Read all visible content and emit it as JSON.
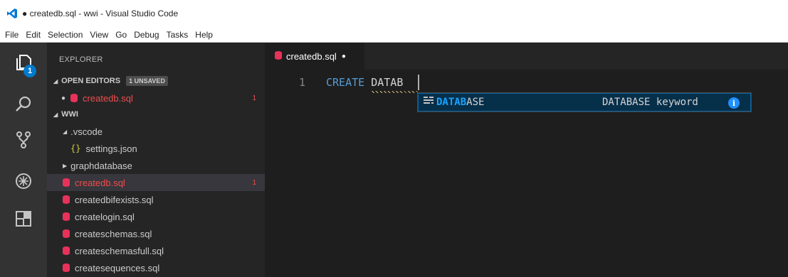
{
  "window": {
    "title": "● createdb.sql - wwi - Visual Studio Code"
  },
  "menu": [
    "File",
    "Edit",
    "Selection",
    "View",
    "Go",
    "Debug",
    "Tasks",
    "Help"
  ],
  "activity_bar": {
    "icons": [
      "explorer-icon",
      "search-icon",
      "source-control-icon",
      "debug-icon",
      "extensions-icon"
    ],
    "explorer_badge": "1"
  },
  "sidebar": {
    "title": "EXPLORER",
    "open_editors": {
      "label": "OPEN EDITORS",
      "badge": "1 UNSAVED",
      "items": [
        {
          "name": "createdb.sql",
          "count": "1"
        }
      ]
    },
    "folder": {
      "label": "WWI",
      "tree": {
        "vscode": ".vscode",
        "settings": "settings.json",
        "graphdatabase": "graphdatabase",
        "files": [
          {
            "name": "createdb.sql",
            "count": "1"
          },
          {
            "name": "createdbifexists.sql"
          },
          {
            "name": "createlogin.sql"
          },
          {
            "name": "createschemas.sql"
          },
          {
            "name": "createschemasfull.sql"
          },
          {
            "name": "createsequences.sql"
          }
        ]
      }
    }
  },
  "editor": {
    "tab": {
      "label": "createdb.sql",
      "dirty": "●"
    },
    "line_number": "1",
    "code": {
      "keyword": "CREATE",
      "partial": "DATAB"
    }
  },
  "suggest": {
    "match": "DATAB",
    "rest": "ASE",
    "detail": "DATABASE keyword",
    "info": "i"
  },
  "colors": {
    "accent": "#007acc",
    "error": "#f14c4c",
    "keyword": "#569cd6",
    "match": "#18a3ff",
    "sql_file_icon": "#e8325a"
  }
}
